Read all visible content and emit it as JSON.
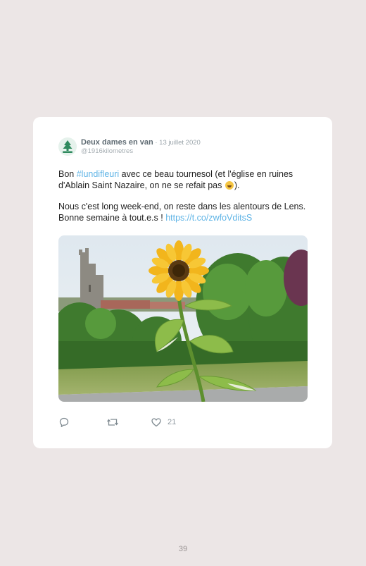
{
  "tweet": {
    "author_name": "Deux dames en van",
    "date": "13 juillet 2020",
    "date_separator": " · ",
    "handle": "@1916kilometres",
    "para1": {
      "pre": "Bon ",
      "hashtag": "#lundifleuri",
      "post": " avec ce beau tournesol (et l'église en ruines d'Ablain Saint Nazaire, on ne se refait pas ",
      "post_end": ")."
    },
    "para2": {
      "text": "Nous c'est long week-end, on reste dans les alentours de Lens. Bonne semaine à tout.e.s ! ",
      "link": "https://t.co/zwfoVditsS"
    },
    "icons": [
      "reply-icon",
      "retweet-icon",
      "heart-icon"
    ],
    "likes": "21"
  },
  "page": {
    "number": "39"
  },
  "colors": {
    "background": "#ece6e6",
    "card": "#ffffff",
    "link": "#5fb4e6",
    "sky": "#e4ecf2",
    "foliage": "#3f7a2e",
    "petal": "#f2b51c"
  }
}
